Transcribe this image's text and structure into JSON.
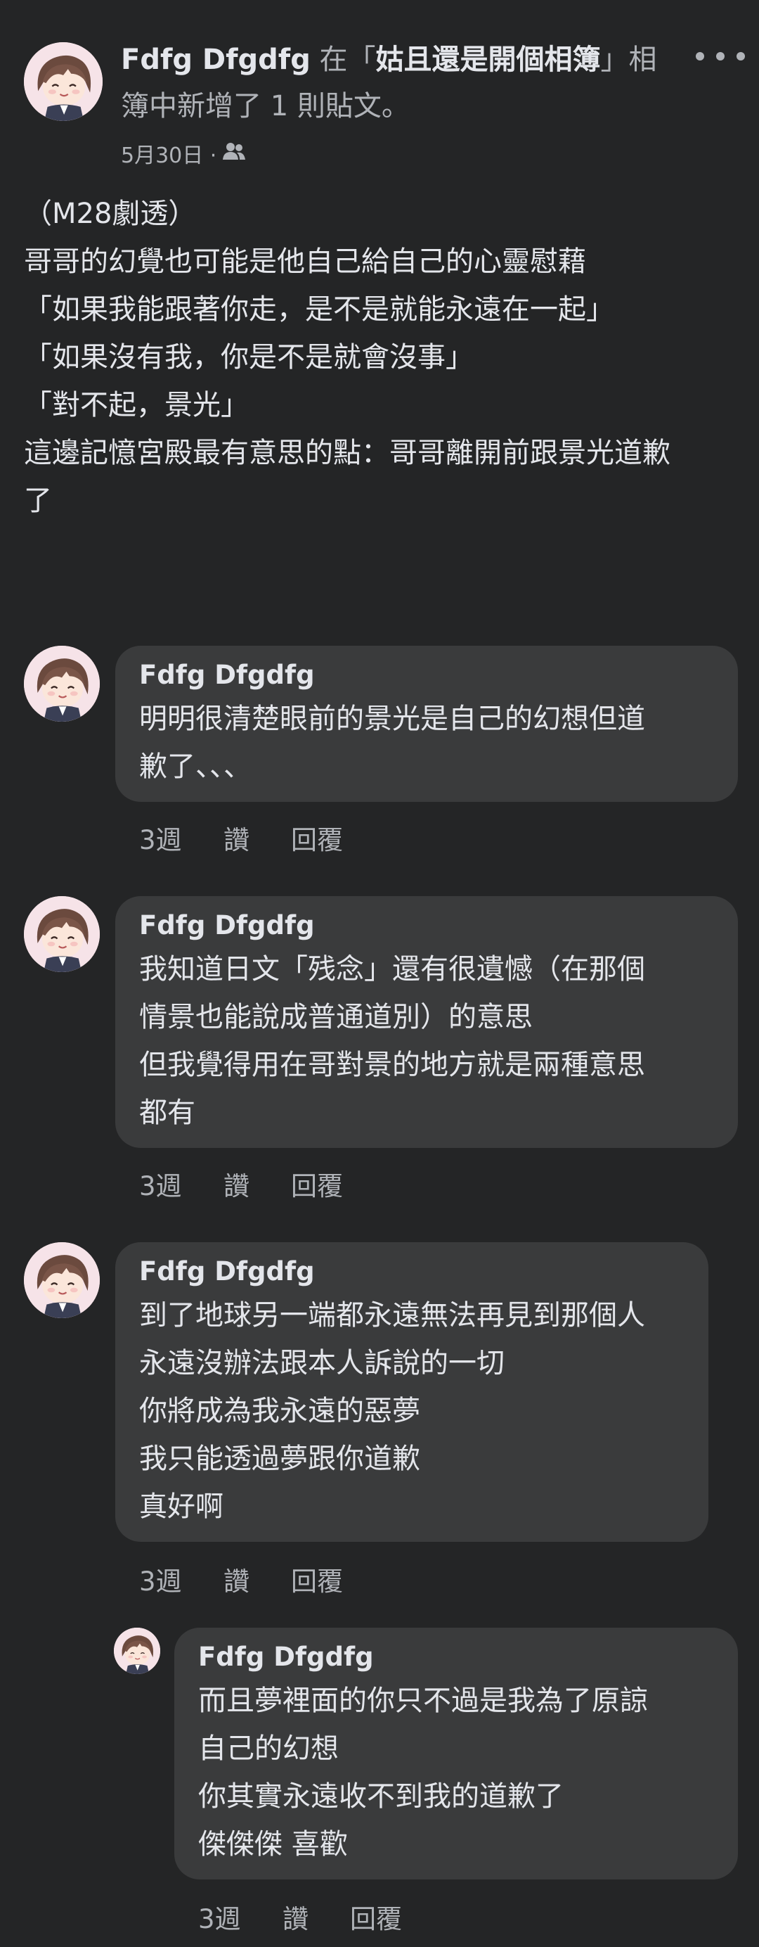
{
  "post": {
    "author": "Fdfg Dfgdfg",
    "header_in": " 在「",
    "album": "姑且還是開個相簿",
    "header_rest_1": "」相",
    "header_rest_2": "簿中新增了 1 則貼文。",
    "date": "5月30日 ·",
    "privacy_icon": "friends-icon",
    "more_icon": "more-horizontal-icon",
    "body_lines": [
      "（M28劇透）",
      "哥哥的幻覺也可能是他自己給自己的心靈慰藉",
      "「如果我能跟著你走，是不是就能永遠在一起」",
      "「如果沒有我，你是不是就會沒事」",
      "「對不起，景光」",
      "這邊記憶宮殿最有意思的點：哥哥離開前跟景光道歉",
      "了"
    ]
  },
  "comments": [
    {
      "author": "Fdfg Dfgdfg",
      "text": "明明很清楚眼前的景光是自己的幻想但道\n歉了、、、",
      "time": "3週",
      "like": "讚",
      "reply": "回覆"
    },
    {
      "author": "Fdfg Dfgdfg",
      "text": "我知道日文「残念」還有很遺憾（在那個\n情景也能說成普通道別）的意思\n但我覺得用在哥對景的地方就是兩種意思\n都有",
      "time": "3週",
      "like": "讚",
      "reply": "回覆"
    },
    {
      "author": "Fdfg Dfgdfg",
      "text": "到了地球另一端都永遠無法再見到那個人\n永遠沒辦法跟本人訴說的一切\n你將成為我永遠的惡夢\n我只能透過夢跟你道歉\n真好啊",
      "time": "3週",
      "like": "讚",
      "reply": "回覆"
    },
    {
      "author": "Fdfg Dfgdfg",
      "text": "而且夢裡面的你只不過是我為了原諒\n自己的幻想\n你其實永遠收不到我的道歉了\n傑傑傑 喜歡",
      "time": "3週",
      "like": "讚",
      "reply": "回覆"
    }
  ],
  "colors": {
    "background": "#242526",
    "bubble": "#3a3b3c",
    "primary_text": "#e4e6eb",
    "secondary_text": "#b0b3b8"
  }
}
